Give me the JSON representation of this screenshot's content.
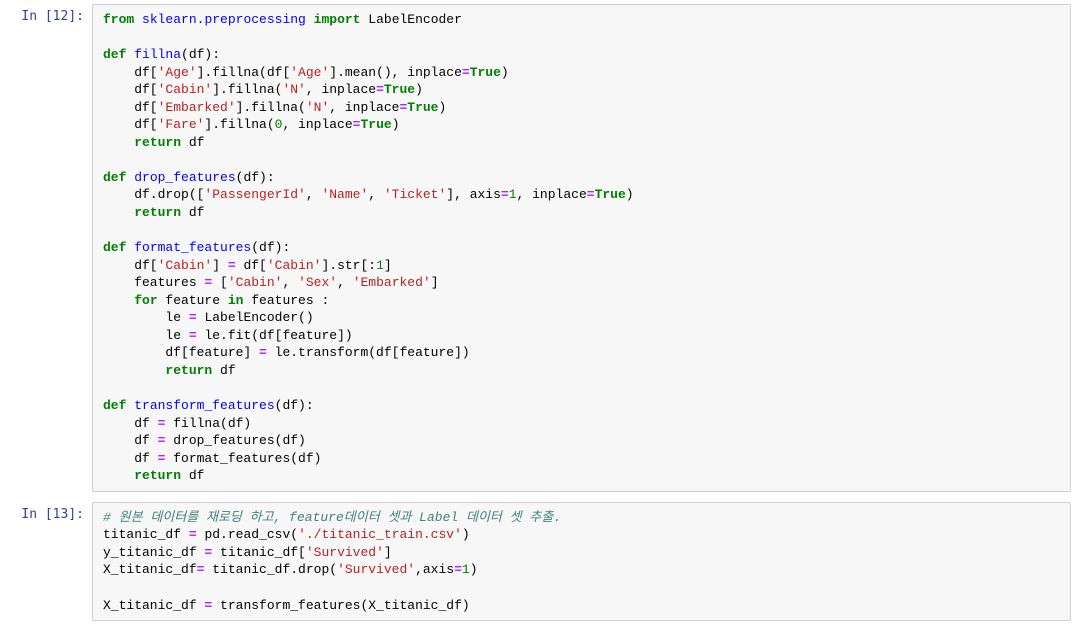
{
  "cells": [
    {
      "prompt": "In [12]:"
    },
    {
      "prompt": "In [13]:"
    }
  ],
  "code1": {
    "l1a": "from",
    "l1b": "sklearn.preprocessing",
    "l1c": "import",
    "l1d": "LabelEncoder",
    "l3a": "def",
    "l3b": "fillna",
    "l3c": "(df):",
    "l4a": "    df[",
    "l4b": "'Age'",
    "l4c": "].fillna(df[",
    "l4d": "'Age'",
    "l4e": "].mean(), inplace",
    "l4f": "=",
    "l4g": "True",
    "l4h": ")",
    "l5a": "    df[",
    "l5b": "'Cabin'",
    "l5c": "].fillna(",
    "l5d": "'N'",
    "l5e": ", inplace",
    "l5f": "=",
    "l5g": "True",
    "l5h": ")",
    "l6a": "    df[",
    "l6b": "'Embarked'",
    "l6c": "].fillna(",
    "l6d": "'N'",
    "l6e": ", inplace",
    "l6f": "=",
    "l6g": "True",
    "l6h": ")",
    "l7a": "    df[",
    "l7b": "'Fare'",
    "l7c": "].fillna(",
    "l7d": "0",
    "l7e": ", inplace",
    "l7f": "=",
    "l7g": "True",
    "l7h": ")",
    "l8a": "    ",
    "l8b": "return",
    "l8c": " df",
    "l10a": "def",
    "l10b": "drop_features",
    "l10c": "(df):",
    "l11a": "    df.drop([",
    "l11b": "'PassengerId'",
    "l11c": ", ",
    "l11d": "'Name'",
    "l11e": ", ",
    "l11f": "'Ticket'",
    "l11g": "], axis",
    "l11h": "=",
    "l11i": "1",
    "l11j": ", inplace",
    "l11k": "=",
    "l11l": "True",
    "l11m": ")",
    "l12a": "    ",
    "l12b": "return",
    "l12c": " df",
    "l14a": "def",
    "l14b": "format_features",
    "l14c": "(df):",
    "l15a": "    df[",
    "l15b": "'Cabin'",
    "l15c": "] ",
    "l15d": "=",
    "l15e": " df[",
    "l15f": "'Cabin'",
    "l15g": "].str[:",
    "l15h": "1",
    "l15i": "]",
    "l16a": "    features ",
    "l16b": "=",
    "l16c": " [",
    "l16d": "'Cabin'",
    "l16e": ", ",
    "l16f": "'Sex'",
    "l16g": ", ",
    "l16h": "'Embarked'",
    "l16i": "]",
    "l17a": "    ",
    "l17b": "for",
    "l17c": " feature ",
    "l17d": "in",
    "l17e": " features :",
    "l18a": "        le ",
    "l18b": "=",
    "l18c": " LabelEncoder()",
    "l19a": "        le ",
    "l19b": "=",
    "l19c": " le.fit(df[feature])",
    "l20a": "        df[feature] ",
    "l20b": "=",
    "l20c": " le.transform(df[feature])",
    "l21a": "        ",
    "l21b": "return",
    "l21c": " df",
    "l23a": "def",
    "l23b": "transform_features",
    "l23c": "(df):",
    "l24a": "    df ",
    "l24b": "=",
    "l24c": " fillna(df)",
    "l25a": "    df ",
    "l25b": "=",
    "l25c": " drop_features(df)",
    "l26a": "    df ",
    "l26b": "=",
    "l26c": " format_features(df)",
    "l27a": "    ",
    "l27b": "return",
    "l27c": " df"
  },
  "code2": {
    "l1a": "# 원본 데이터를 재로딩 하고, feature데이터 셋과 Label 데이터 셋 추출.",
    "l2a": "titanic_df ",
    "l2b": "=",
    "l2c": " pd.read_csv(",
    "l2d": "'./titanic_train.csv'",
    "l2e": ")",
    "l3a": "y_titanic_df ",
    "l3b": "=",
    "l3c": " titanic_df[",
    "l3d": "'Survived'",
    "l3e": "]",
    "l4a": "X_titanic_df",
    "l4b": "=",
    "l4c": " titanic_df.drop(",
    "l4d": "'Survived'",
    "l4e": ",axis",
    "l4f": "=",
    "l4g": "1",
    "l4h": ")",
    "l6a": "X_titanic_df ",
    "l6b": "=",
    "l6c": " transform_features(X_titanic_df)"
  }
}
